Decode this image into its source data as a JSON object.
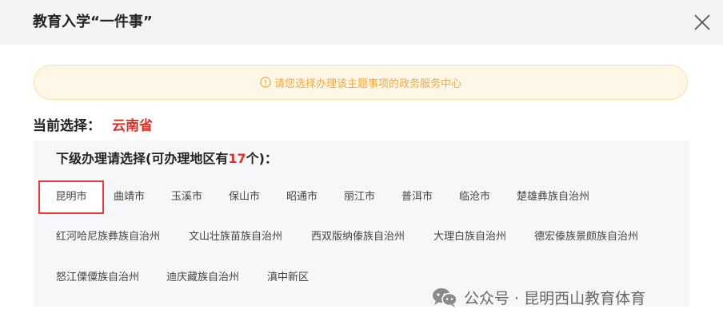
{
  "dialog": {
    "title": "教育入学“一件事”",
    "notice": "请您选择办理该主题事项的政务服务中心"
  },
  "current": {
    "label": "当前选择：",
    "value": "云南省"
  },
  "panel": {
    "subheading_prefix": "下级办理请选择(可办理地区有",
    "count": "17",
    "subheading_suffix": "个)：",
    "regions": [
      "昆明市",
      "曲靖市",
      "玉溪市",
      "保山市",
      "昭通市",
      "丽江市",
      "普洱市",
      "临沧市",
      "楚雄彝族自治州",
      "红河哈尼族彝族自治州",
      "文山壮族苗族自治州",
      "西双版纳傣族自治州",
      "大理白族自治州",
      "德宏傣族景颇族自治州",
      "怒江傈僳族自治州",
      "迪庆藏族自治州",
      "滇中新区"
    ],
    "selected_region": "昆明市"
  },
  "watermark": {
    "text": "公众号 · 昆明西山教育体育"
  },
  "colors": {
    "accent_red": "#d9312b",
    "notice_text": "#f0a93e",
    "notice_bg": "#fef6e6",
    "panel_bg": "#f7f7f9"
  },
  "icons": {
    "close": "close-icon",
    "notice": "info-circle-icon",
    "watermark": "wechat-icon"
  }
}
